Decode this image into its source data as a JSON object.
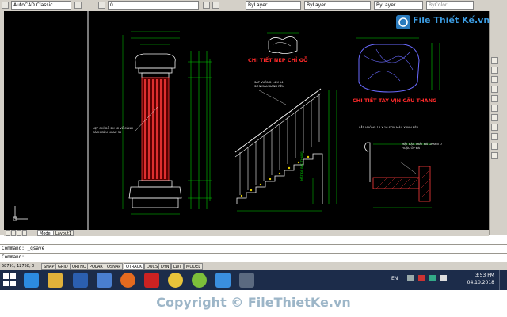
{
  "toolbar": {
    "workspace": "AutoCAD Classic",
    "layer": "0",
    "color": "ByLayer",
    "linetype": "ByLayer",
    "lineweight": "ByLayer",
    "plotstyle": "ByColor"
  },
  "drawing": {
    "title_molding": "CHI TIẾT NẸP CHỈ GỖ",
    "title_handrail": "CHI TIẾT TAY VỊN CẦU THANG",
    "note_column": "NẸP CHỈ GỖ ĐK 12 VỀ CẢNH CÁCH ĐỀU NHAU 35",
    "note_stair": "SẮT VUÔNG 14 X 14 SƠN MÀU XANH RÊU",
    "note_bar": "SẮT VUÔNG 16 X 16 SƠN MÀU XANH RÊU",
    "note_handrail": "MẶT BẬC TRẤT ĐÁ GRANITO HOẶC ỐP ĐÁ",
    "note_vertical": "MẶT ĐÁ BẬC THANG"
  },
  "tabs": [
    "Model",
    "Layout1"
  ],
  "command": {
    "line1": "Command: _qsave",
    "line2": "Command:"
  },
  "status": {
    "coords": "58791, 12758, 0",
    "buttons": [
      "SNAP",
      "GRID",
      "ORTHO",
      "POLAR",
      "OSNAP",
      "OTRACK",
      "DUCS",
      "DYN",
      "LWT",
      "MODEL"
    ]
  },
  "taskbar": {
    "lang": "EN",
    "time": "3:53 PM",
    "date": "04.10.2018"
  },
  "branding": {
    "logo_text": "File Thiết Kế.vn",
    "copyright": "Copyright © FileThietKe.vn"
  },
  "colors": {
    "canvas": "#000000",
    "dimension": "#00d400",
    "title_red": "#ff2a2a",
    "column": "#ff3b3b",
    "geometry": "#f2f2f2",
    "handrail_blue": "#6a6aff",
    "taskbar": "#1c2c4a",
    "accent": "#2a7bbd"
  }
}
